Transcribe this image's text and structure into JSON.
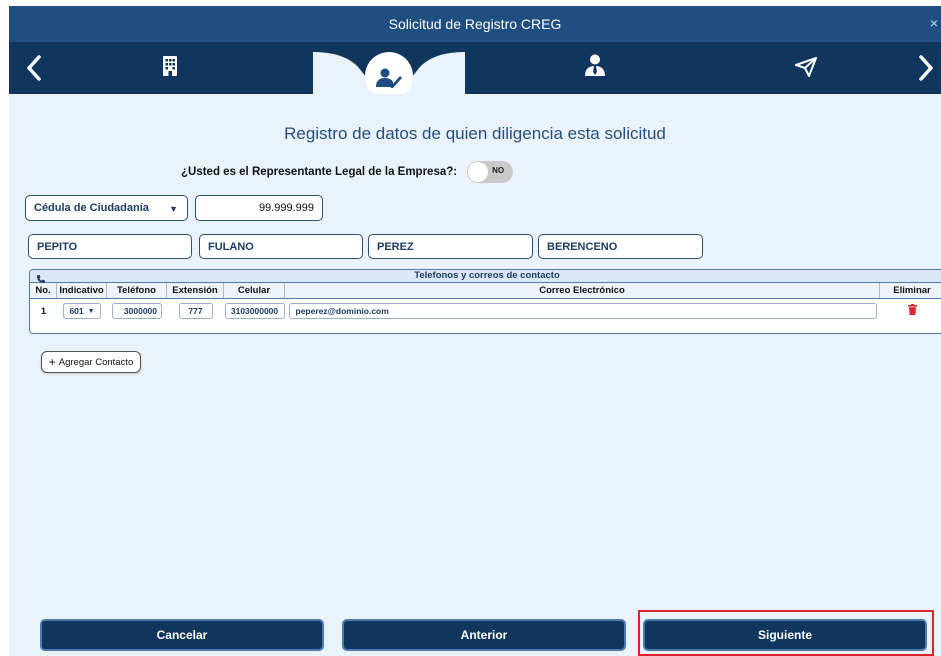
{
  "window": {
    "title": "Solicitud de Registro CREG",
    "close_label": "×"
  },
  "nav": {
    "steps": [
      "building-icon",
      "user-edit-icon",
      "user-tie-icon",
      "paper-plane-icon"
    ],
    "active_step": 2
  },
  "heading": "Registro de datos de quien diligencia esta solicitud",
  "legal_rep": {
    "question": "¿Usted es el Representante Legal de la Empresa?:",
    "toggle_value": "NO"
  },
  "identity": {
    "doc_type": "Cédula de Ciudadanía",
    "doc_number": "99.999.999",
    "names": [
      "PEPITO",
      "FULANO",
      "PEREZ",
      "BERENCENO"
    ]
  },
  "contacts": {
    "title": "Telefonos y correos de contacto",
    "columns": [
      "No.",
      "Indicativo",
      "Teléfono",
      "Extensión",
      "Celular",
      "Correo Electrónico",
      "Eliminar"
    ],
    "rows": [
      {
        "no": "1",
        "indicativo": "601",
        "telefono": "3000000",
        "extension": "777",
        "celular": "3103000000",
        "correo": "peperez@dominio.com"
      }
    ]
  },
  "add_contact_label": "Agregar Contacto",
  "buttons": {
    "cancel": "Cancelar",
    "previous": "Anterior",
    "next": "Siguiente"
  },
  "colors": {
    "primary": "#11365e",
    "title_bar": "#1f4f80",
    "background": "#eaf3fc",
    "highlight": "#d8232a",
    "delete": "#e0262a"
  }
}
